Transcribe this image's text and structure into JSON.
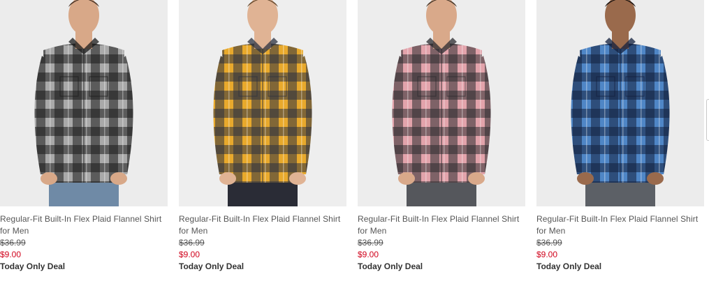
{
  "products": [
    {
      "title": "Regular-Fit Built-In Flex Plaid Flannel Shirt for Men",
      "original_price": "$36.99",
      "sale_price": "$9.00",
      "deal_label": "Today Only Deal",
      "colors": {
        "bg": "#ececec",
        "light": "#a9a9a9",
        "dark": "#1b1b1b",
        "skin": "#d8a888",
        "hair": "#4a3426",
        "pants": "#6f8aa6"
      }
    },
    {
      "title": "Regular-Fit Built-In Flex Plaid Flannel Shirt for Men",
      "original_price": "$36.99",
      "sale_price": "$9.00",
      "deal_label": "Today Only Deal",
      "colors": {
        "bg": "#eeeeee",
        "light": "#e8a92c",
        "dark": "#2c3140",
        "skin": "#e0b394",
        "hair": "#6a4e32",
        "pants": "#2a2c36"
      }
    },
    {
      "title": "Regular-Fit Built-In Flex Plaid Flannel Shirt for Men",
      "original_price": "$36.99",
      "sale_price": "$9.00",
      "deal_label": "Today Only Deal",
      "colors": {
        "bg": "#ededed",
        "light": "#e2a3ab",
        "dark": "#2b2b2f",
        "skin": "#d9a98a",
        "hair": "#4a3a2c",
        "pants": "#55575c"
      }
    },
    {
      "title": "Regular-Fit Built-In Flex Plaid Flannel Shirt for Men",
      "original_price": "$36.99",
      "sale_price": "$9.00",
      "deal_label": "Today Only Deal",
      "colors": {
        "bg": "#ececec",
        "light": "#4f86c6",
        "dark": "#13203d",
        "skin": "#9a6a4c",
        "hair": "#1e1612",
        "pants": "#5c6066"
      }
    }
  ]
}
